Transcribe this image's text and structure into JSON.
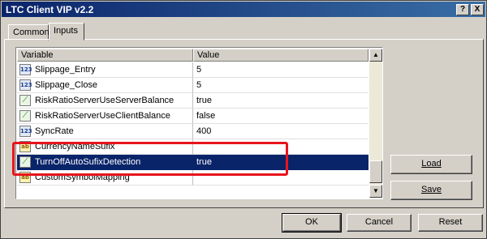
{
  "window": {
    "title": "LTC Client VIP v2.2"
  },
  "titlebar_buttons": {
    "help": "?",
    "close": "X"
  },
  "tabs": [
    "Common",
    "Inputs"
  ],
  "grid": {
    "headers": {
      "variable": "Variable",
      "value": "Value"
    },
    "rows": [
      {
        "icon": "number-icon",
        "variable": "Slippage_Entry",
        "value": "5"
      },
      {
        "icon": "number-icon",
        "variable": "Slippage_Close",
        "value": "5"
      },
      {
        "icon": "chart-icon",
        "variable": "RiskRatioServerUseServerBalance",
        "value": "true"
      },
      {
        "icon": "chart-icon",
        "variable": "RiskRatioServerUseClientBalance",
        "value": "false"
      },
      {
        "icon": "number-icon",
        "variable": "SyncRate",
        "value": "400"
      },
      {
        "icon": "string-icon",
        "variable": "CurrencyNameSufix",
        "value": ""
      },
      {
        "icon": "chart-icon",
        "variable": "TurnOffAutoSufixDetection",
        "value": "true",
        "selected": true
      },
      {
        "icon": "string-icon",
        "variable": "CustomSymbolMapping",
        "value": ""
      }
    ]
  },
  "icon_glyphs": {
    "number": "123",
    "chart": "⟋",
    "string": "ab"
  },
  "side_buttons": {
    "load": "Load",
    "save": "Save"
  },
  "footer_buttons": {
    "ok": "OK",
    "cancel": "Cancel",
    "reset": "Reset"
  },
  "colors": {
    "highlight_box": "#e8141c",
    "selection": "#0a246a",
    "titlebar": "#0a246a"
  }
}
